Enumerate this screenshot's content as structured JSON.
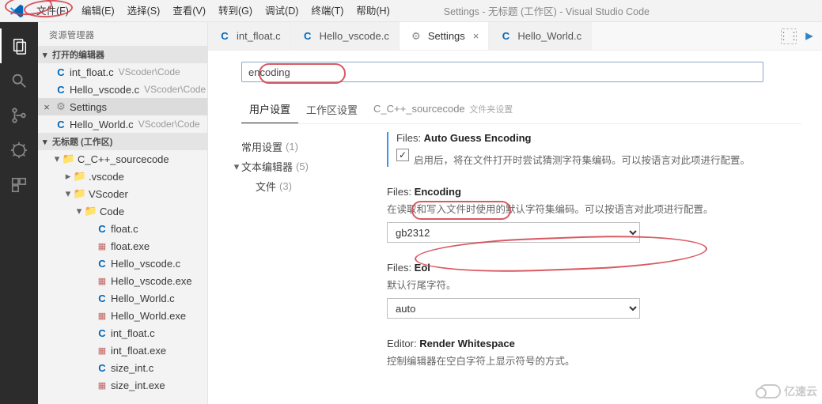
{
  "menubar": {
    "items": [
      "文件(F)",
      "编辑(E)",
      "选择(S)",
      "查看(V)",
      "转到(G)",
      "调试(D)",
      "终端(T)",
      "帮助(H)"
    ],
    "title": "Settings - 无标题 (工作区) - Visual Studio Code"
  },
  "sidebar": {
    "title": "资源管理器",
    "sections": {
      "openEditors": {
        "label": "打开的编辑器",
        "items": [
          {
            "icon": "c",
            "name": "int_float.c",
            "hint": "VScoder\\Code"
          },
          {
            "icon": "c",
            "name": "Hello_vscode.c",
            "hint": "VScoder\\Code"
          },
          {
            "icon": "gear",
            "name": "Settings",
            "active": true,
            "close": true
          },
          {
            "icon": "c",
            "name": "Hello_World.c",
            "hint": "VScoder\\Code"
          }
        ]
      },
      "workspace": {
        "label": "无标题 (工作区)",
        "tree": [
          {
            "depth": 1,
            "tw": "down",
            "icon": "folder",
            "name": "C_C++_sourcecode"
          },
          {
            "depth": 2,
            "tw": "right",
            "icon": "folder-blue",
            "name": ".vscode"
          },
          {
            "depth": 2,
            "tw": "down",
            "icon": "folder",
            "name": "VScoder"
          },
          {
            "depth": 3,
            "tw": "down",
            "icon": "folder",
            "name": "Code"
          },
          {
            "depth": 4,
            "tw": "",
            "icon": "c",
            "name": "float.c"
          },
          {
            "depth": 4,
            "tw": "",
            "icon": "exe",
            "name": "float.exe"
          },
          {
            "depth": 4,
            "tw": "",
            "icon": "c",
            "name": "Hello_vscode.c"
          },
          {
            "depth": 4,
            "tw": "",
            "icon": "exe",
            "name": "Hello_vscode.exe"
          },
          {
            "depth": 4,
            "tw": "",
            "icon": "c",
            "name": "Hello_World.c"
          },
          {
            "depth": 4,
            "tw": "",
            "icon": "exe",
            "name": "Hello_World.exe"
          },
          {
            "depth": 4,
            "tw": "",
            "icon": "c",
            "name": "int_float.c"
          },
          {
            "depth": 4,
            "tw": "",
            "icon": "exe",
            "name": "int_float.exe"
          },
          {
            "depth": 4,
            "tw": "",
            "icon": "c",
            "name": "size_int.c"
          },
          {
            "depth": 4,
            "tw": "",
            "icon": "exe",
            "name": "size_int.exe"
          }
        ]
      }
    }
  },
  "tabs": [
    {
      "icon": "c",
      "label": "int_float.c"
    },
    {
      "icon": "c",
      "label": "Hello_vscode.c"
    },
    {
      "icon": "gear",
      "label": "Settings",
      "active": true,
      "close": true
    },
    {
      "icon": "c",
      "label": "Hello_World.c"
    }
  ],
  "settings": {
    "search_value": "encoding",
    "scope_tabs": {
      "user": "用户设置",
      "workspace": "工作区设置",
      "folder": "C_C++_sourcecode",
      "folder_sub": "文件夹设置"
    },
    "toc": {
      "common": {
        "label": "常用设置",
        "count": "(1)"
      },
      "textEditor": {
        "label": "文本编辑器",
        "count": "(5)",
        "expanded": true
      },
      "files": {
        "label": "文件",
        "count": "(3)"
      }
    },
    "items": {
      "autoGuess": {
        "group": "Files: ",
        "name": "Auto Guess Encoding",
        "checked": true,
        "desc": "启用后，将在文件打开时尝试猜测字符集编码。可以按语言对此项进行配置。"
      },
      "encoding": {
        "group": "Files: ",
        "name": "Encoding",
        "desc": "在读取和写入文件时使用的默认字符集编码。可以按语言对此项进行配置。",
        "value": "gb2312"
      },
      "eol": {
        "group": "Files: ",
        "name": "Eol",
        "desc": "默认行尾字符。",
        "value": "auto"
      },
      "renderWs": {
        "group": "Editor: ",
        "name": "Render Whitespace",
        "desc": "控制编辑器在空白字符上显示符号的方式。"
      }
    }
  },
  "watermark": "亿速云"
}
